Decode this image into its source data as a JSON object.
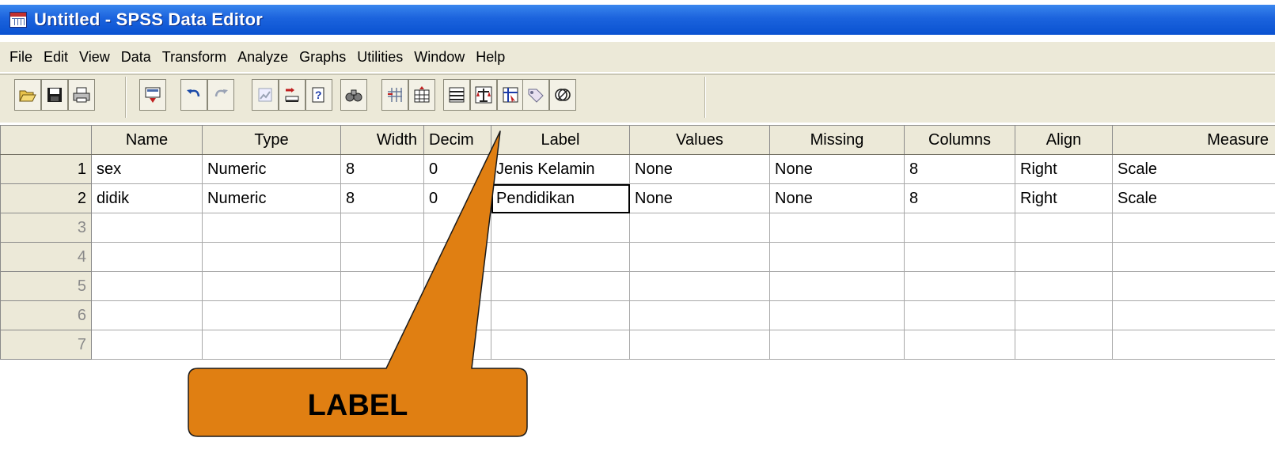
{
  "window": {
    "title": "Untitled - SPSS Data Editor"
  },
  "menu": [
    "File",
    "Edit",
    "View",
    "Data",
    "Transform",
    "Analyze",
    "Graphs",
    "Utilities",
    "Window",
    "Help"
  ],
  "toolbar": {
    "groups": [
      [
        "open-icon",
        "save-icon",
        "print-icon"
      ],
      [
        "dialog-recall-icon"
      ],
      [
        "undo-icon",
        "redo-icon"
      ],
      [
        "goto-chart-icon",
        "goto-case-icon",
        "variables-icon"
      ],
      [
        "find-icon"
      ],
      [
        "insert-cases-icon",
        "insert-variable-icon"
      ],
      [
        "split-file-icon",
        "weight-cases-icon",
        "select-cases-icon"
      ],
      [
        "value-labels-icon",
        "use-sets-icon"
      ]
    ]
  },
  "grid": {
    "columns": [
      "",
      "Name",
      "Type",
      "Width",
      "Decim",
      "Label",
      "Values",
      "Missing",
      "Columns",
      "Align",
      "Measure"
    ],
    "rows": [
      [
        "1",
        "sex",
        "Numeric",
        "8",
        "0",
        "Jenis Kelamin",
        "None",
        "None",
        "8",
        "Right",
        "Scale"
      ],
      [
        "2",
        "didik",
        "Numeric",
        "8",
        "0",
        "Pendidikan",
        "None",
        "None",
        "8",
        "Right",
        "Scale"
      ],
      [
        "3",
        "",
        "",
        "",
        "",
        "",
        "",
        "",
        "",
        "",
        ""
      ],
      [
        "4",
        "",
        "",
        "",
        "",
        "",
        "",
        "",
        "",
        "",
        ""
      ],
      [
        "5",
        "",
        "",
        "",
        "",
        "",
        "",
        "",
        "",
        "",
        ""
      ],
      [
        "6",
        "",
        "",
        "",
        "",
        "",
        "",
        "",
        "",
        "",
        ""
      ],
      [
        "7",
        "",
        "",
        "",
        "",
        "",
        "",
        "",
        "",
        "",
        ""
      ]
    ]
  },
  "callout": {
    "text": "LABEL",
    "color": "#e07f12"
  },
  "colors": {
    "titlebar": "#0a52d1",
    "chrome": "#ece9d8"
  }
}
